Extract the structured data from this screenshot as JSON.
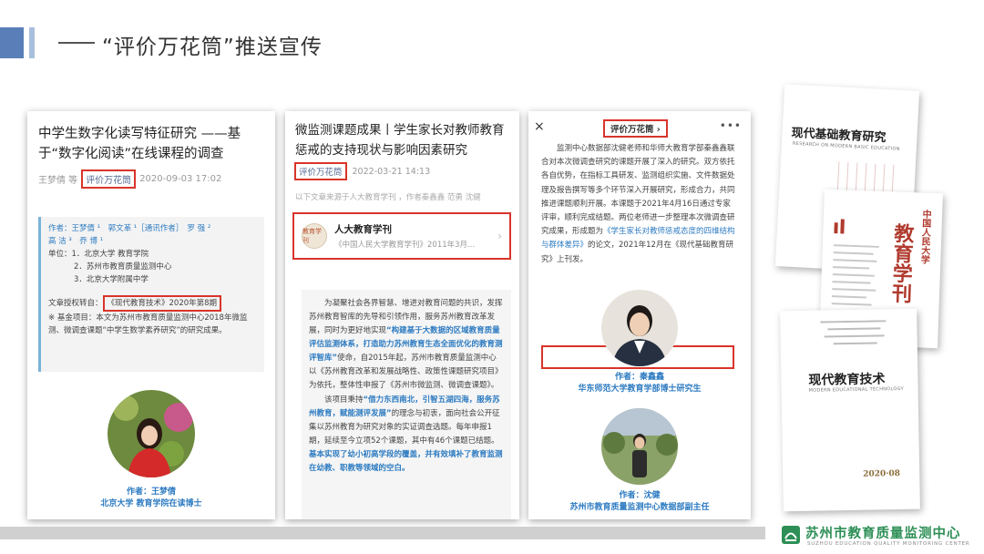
{
  "slide": {
    "title": "“评价万花筒”推送宣传"
  },
  "card1": {
    "title": "中学生数字化读写特征研究 ——基于“数字化阅读”在线课程的调查",
    "author": "王梦倩 等",
    "tag": "评价万花筒",
    "date": "2020-09-03 17:02",
    "authors_line1": "作者：王梦倩 ¹　郭文革 ¹［通讯作者］　罗 强 ²",
    "authors_line2": "高 洁 ³　乔 博 ¹",
    "unit1": "单位：1．北京大学 教育学院",
    "unit2": "2．苏州市教育质量监测中心",
    "unit3": "3．北京大学附属中学",
    "reprint_prefix": "文章授权转自：",
    "reprint_source": "《现代教育技术》2020年第8期",
    "fund": "※ 基金项目：本文为苏州市教育质量监测中心2018年微监测、微调查课题“中学生数学素养研究”的研究成果。",
    "caption_name": "作者：王梦倩",
    "caption_org": "北京大学 教育学院在读博士"
  },
  "card2": {
    "title": "微监测课题成果丨学生家长对教师教育惩戒的支持现状与影响因素研究",
    "tag": "评价万花筒",
    "date": "2022-03-21 14:13",
    "note": "以下文章来源于人大教育学刊 ，作者秦鑫鑫 范勇 沈健",
    "account_name": "人大教育学刊",
    "account_desc": "《中国人民大学教育学刊》2011年3月...",
    "account_logo": "教育学刊",
    "p1_a": "为凝聚社会各界智慧、增进对教育问题的共识，发挥苏州教育智库的先导和引领作用，服务苏州教育改革发展，同时为更好地实现",
    "p1_hl": "“构建基于大数据的区域教育质量评估监测体系，打造助力苏州教育生态全面优化的教育测评智库”",
    "p1_b": "使命，自2015年起，苏州市教育质量监测中心以《苏州教育改革和发展战略性、政策性课题研究项目》为依托，整体性申报了《苏州市微监测、微调查课题》。",
    "p2_a": "该项目秉持",
    "p2_hl": "“借力东西南北，引智五湖四海，服务苏州教育，赋能测评发展”",
    "p2_b": "的理念与初衷，面向社会公开征集以苏州教育为研究对象的实证调查选题。每年申报1期，延续至今立项52个课题，其中有46个课题已结题。",
    "p2_hl2": "基本实现了幼小初高学段的覆盖，并有效填补了教育监测在幼教、职教等领域的空白。"
  },
  "card3": {
    "tag": "评价万花筒 ›",
    "close": "×",
    "more": "•••",
    "body_a": "监测中心数据部沈健老师和华师大教育学部秦鑫鑫联合对本次微调查研究的课题开展了深入的研究。双方依托各自优势，在指标工具研发、监测组织实施、文件数据处理及报告撰写等多个环节深入开展研究，形成合力，共同推进课题顺利开展。本课题于2021年4月16日通过专家评审，顺利完成结题。两位老师进一步整理本次微调查研究成果，形成题为",
    "body_hl": "《学生家长对教师惩戒态度的四维结构与群体差异》",
    "body_b": "的论文，2021年12月在《现代基础教育研究》上刊发。",
    "cap1_name": "作者：秦鑫鑫",
    "cap1_org": "华东师范大学教育学部博士研究生",
    "cap2_name": "作者：沈健",
    "cap2_org": "苏州市教育质量监测中心数据部副主任"
  },
  "journals": {
    "j1_title": "现代基础教育研究",
    "j1_sub": "RESEARCH ON MODERN BASIC EDUCATION",
    "j2_title": "教育学刊",
    "j2_side": "中国人民大学",
    "j3_title": "现代教育技术",
    "j3_sub": "MODERN EDUCATIONAL TECHNOLOGY",
    "j3_issue": "2020·08"
  },
  "footer": {
    "org_name": "苏州市教育质量监测中心",
    "org_en": "SUZHOU EDUCATION QUALITY MONITORING CENTER"
  }
}
